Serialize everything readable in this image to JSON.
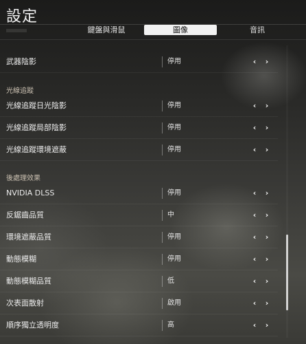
{
  "page_title": "設定",
  "tabs": [
    {
      "label": "鍵盤與滑鼠",
      "active": false
    },
    {
      "label": "圖像",
      "active": true
    },
    {
      "label": "音訊",
      "active": false
    }
  ],
  "arrows": {
    "left": "‹",
    "right": "›"
  },
  "rows": [
    {
      "label": "武器陰影",
      "value": "停用"
    },
    {
      "label": "光線追蹤日光陰影",
      "value": "停用"
    },
    {
      "label": "光線追蹤局部陰影",
      "value": "停用"
    },
    {
      "label": "光線追蹤環境遮蔽",
      "value": "停用"
    },
    {
      "label": "NVIDIA DLSS",
      "value": "停用"
    },
    {
      "label": "反鋸齒品質",
      "value": "中"
    },
    {
      "label": "環境遮蔽品質",
      "value": "停用"
    },
    {
      "label": "動態模糊",
      "value": "停用"
    },
    {
      "label": "動態模糊品質",
      "value": "低"
    },
    {
      "label": "次表面散射",
      "value": "啟用"
    },
    {
      "label": "順序獨立透明度",
      "value": "高"
    }
  ],
  "sections": [
    {
      "label": "光線追蹤"
    },
    {
      "label": "後處理效果"
    }
  ],
  "scrollbar": {
    "position_fraction": 0.72
  }
}
